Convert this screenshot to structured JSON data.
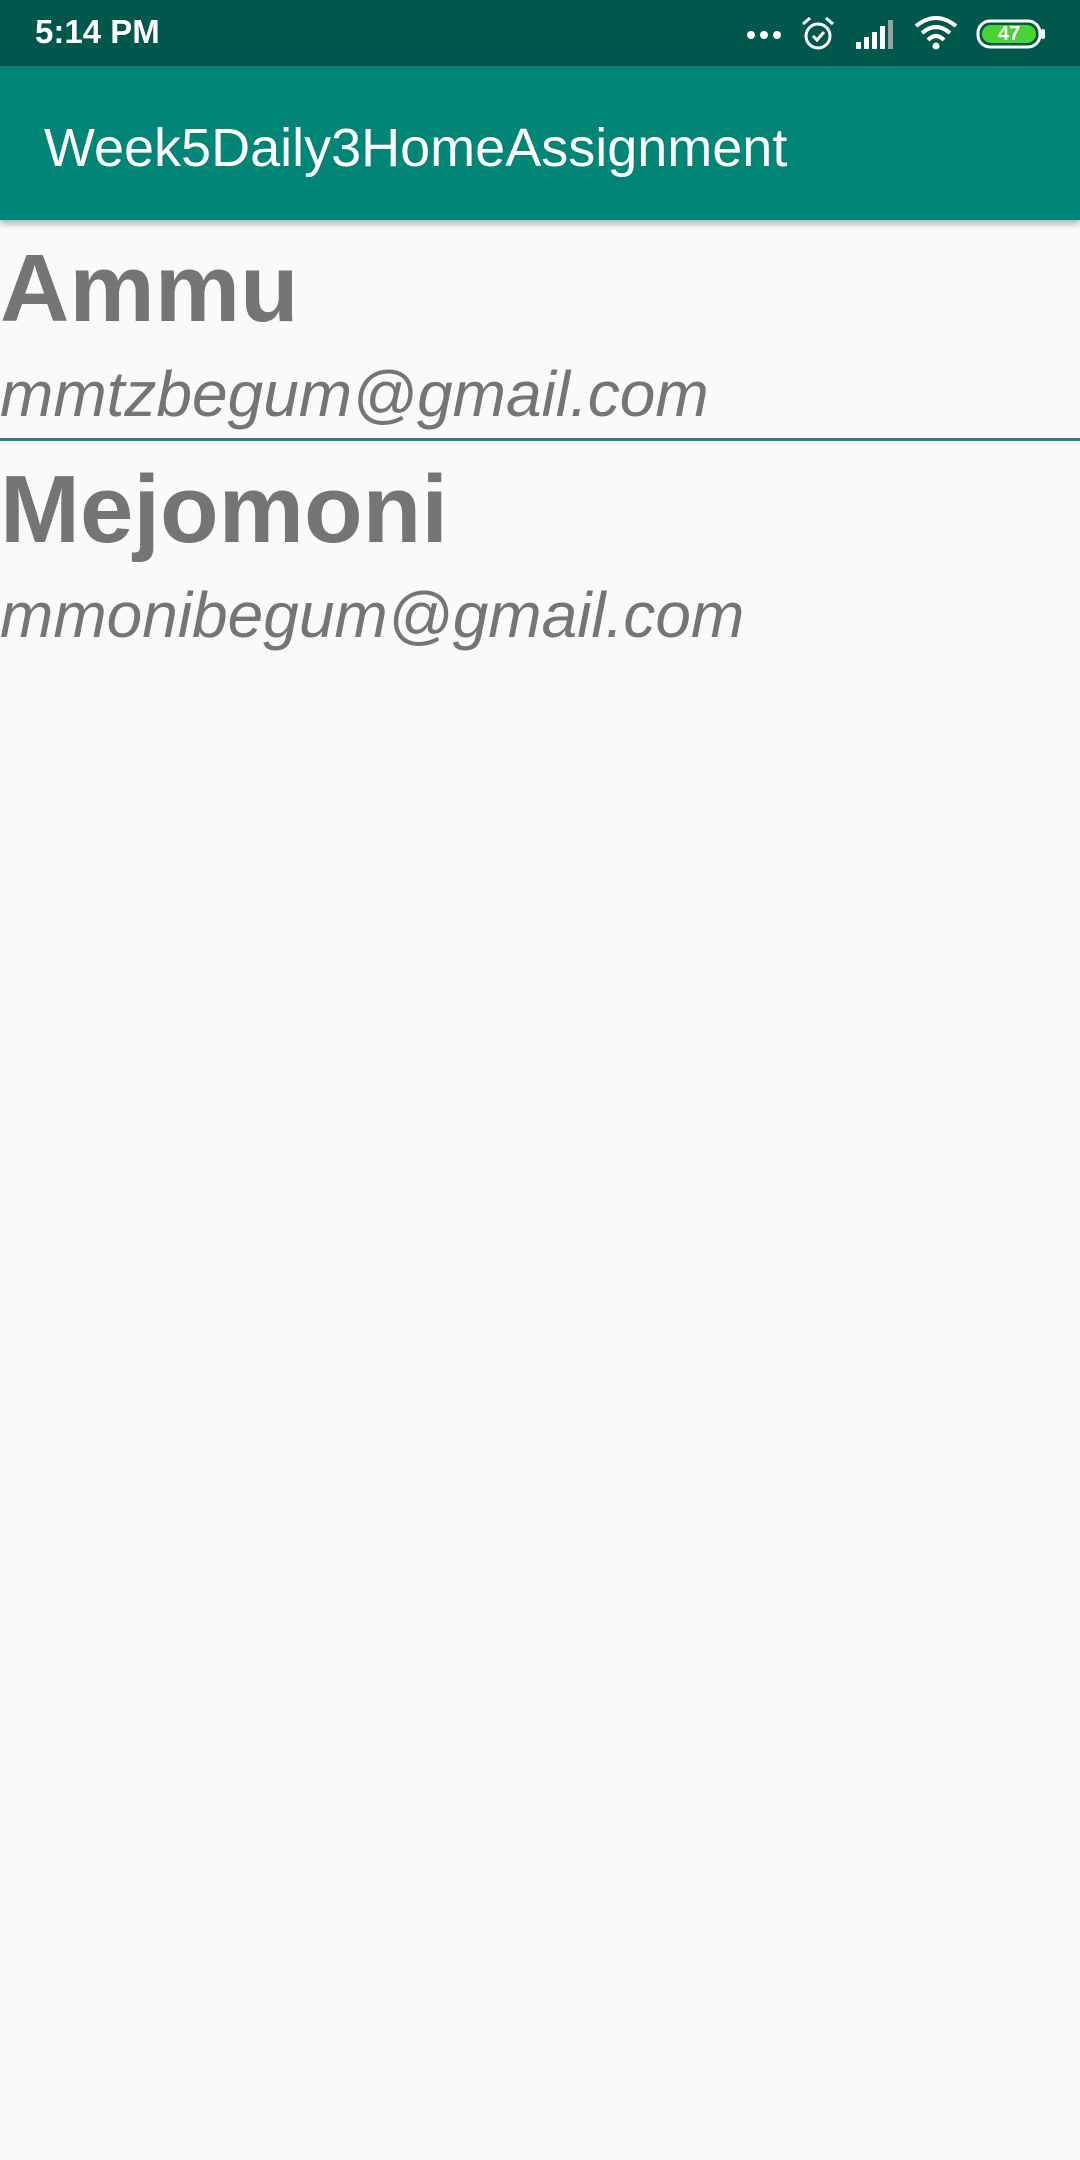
{
  "status_bar": {
    "time": "5:14 PM",
    "battery_level": "47",
    "icons": [
      "more-dots-icon",
      "alarm-icon",
      "signal-icon",
      "wifi-icon",
      "battery-icon"
    ]
  },
  "app_bar": {
    "title": "Week5Daily3HomeAssignment"
  },
  "list": {
    "items": [
      {
        "name": "Ammu",
        "email": "mmtzbegum@gmail.com"
      },
      {
        "name": "Mejomoni",
        "email": "mmonibegum@gmail.com"
      }
    ]
  },
  "colors": {
    "status_bar": "#00574b",
    "app_bar": "#008577",
    "text": "#757575",
    "divider": "#2a7f78",
    "background": "#fafafa",
    "battery_fill": "#4cd137"
  }
}
